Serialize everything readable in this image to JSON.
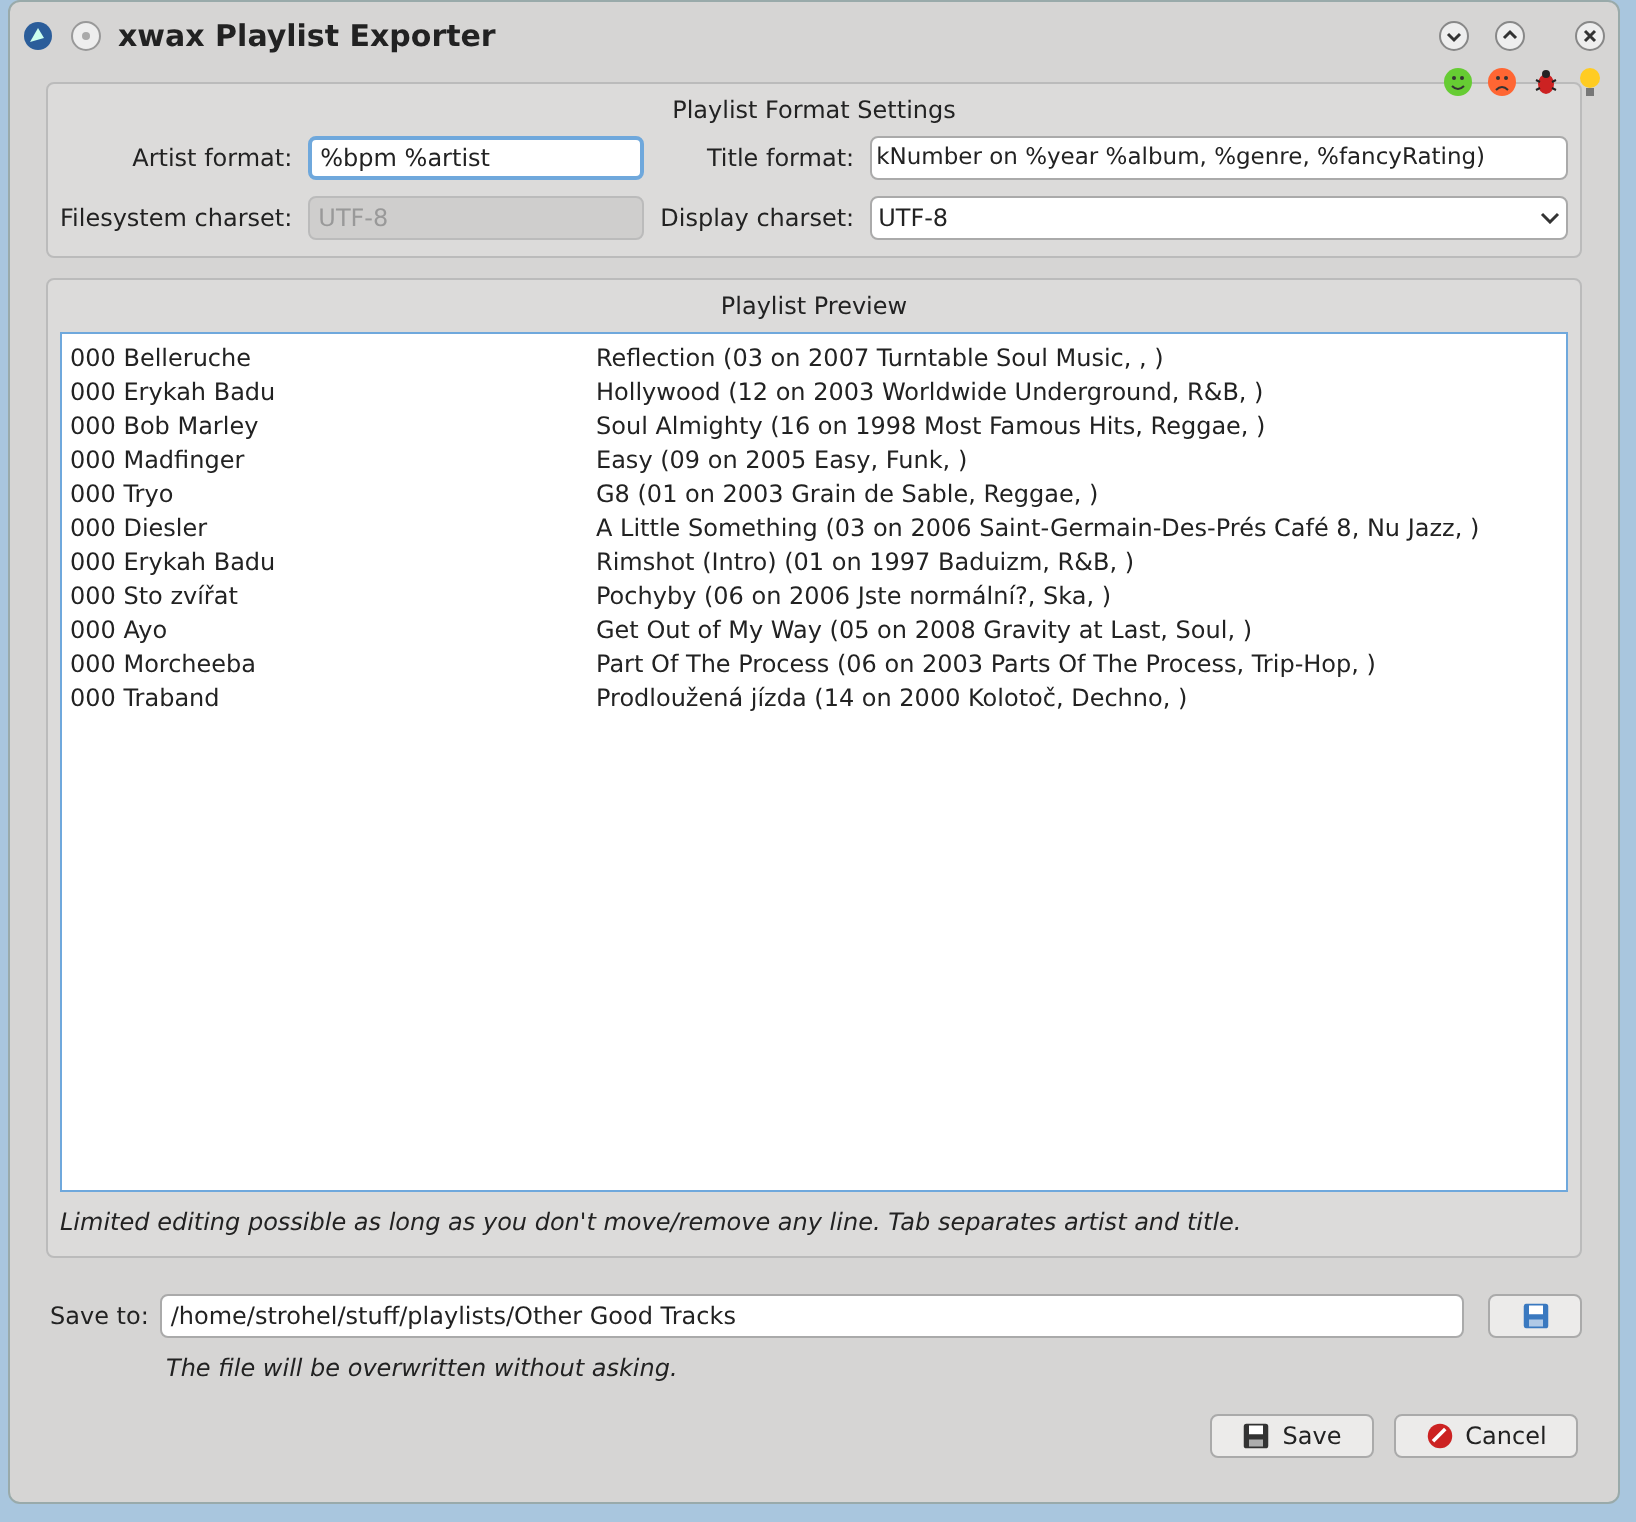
{
  "window": {
    "title": "xwax Playlist Exporter"
  },
  "format_settings": {
    "title": "Playlist Format Settings",
    "artist_format": {
      "label": "Artist format:",
      "value": "%bpm %artist"
    },
    "title_format": {
      "label": "Title format:",
      "value": "kNumber on %year %album, %genre, %fancyRating)"
    },
    "filesystem_charset": {
      "label": "Filesystem charset:",
      "value": "UTF-8",
      "disabled": true
    },
    "display_charset": {
      "label": "Display charset:",
      "value": "UTF-8"
    }
  },
  "preview": {
    "title": "Playlist Preview",
    "rows": [
      {
        "artist": "000 Belleruche",
        "title": "Reflection (03 on 2007 Turntable Soul Music, , )"
      },
      {
        "artist": "000 Erykah Badu",
        "title": "Hollywood (12 on 2003 Worldwide Underground, R&B, )"
      },
      {
        "artist": "000 Bob Marley",
        "title": "Soul Almighty (16 on 1998 Most Famous Hits, Reggae, )"
      },
      {
        "artist": "000 Madfinger",
        "title": "Easy (09 on 2005 Easy, Funk, )"
      },
      {
        "artist": "000 Tryo",
        "title": "G8 (01 on 2003 Grain de Sable, Reggae, )"
      },
      {
        "artist": "000 Diesler",
        "title": "A Little Something (03 on 2006 Saint-Germain-Des-Prés Café 8, Nu Jazz, )"
      },
      {
        "artist": "000 Erykah Badu",
        "title": "Rimshot (Intro) (01 on 1997 Baduizm, R&B, )"
      },
      {
        "artist": "000 Sto zvířat",
        "title": "Pochyby (06 on 2006 Jste normální?, Ska, )"
      },
      {
        "artist": "000 Ayo",
        "title": "Get Out of My Way (05 on 2008 Gravity at Last, Soul, )"
      },
      {
        "artist": "000 Morcheeba",
        "title": "Part Of The Process (06 on 2003 Parts Of The Process, Trip-Hop, )"
      },
      {
        "artist": "000 Traband",
        "title": "Prodloužená jízda (14 on 2000 Kolotoč, Dechno, )"
      }
    ],
    "hint": "Limited editing possible as long as you don't move/remove any line. Tab separates artist and title."
  },
  "save_to": {
    "label": "Save to:",
    "value": "/home/strohel/stuff/playlists/Other Good Tracks",
    "note": "The file will be overwritten without asking."
  },
  "buttons": [
    {
      "label": "Save",
      "kind": "save"
    },
    {
      "label": "Cancel",
      "kind": "cancel"
    }
  ]
}
